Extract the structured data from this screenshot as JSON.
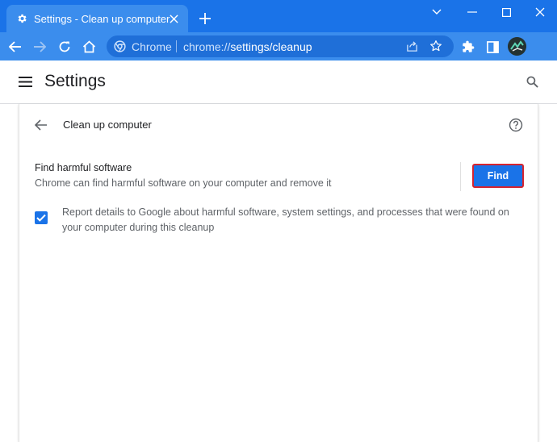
{
  "tab": {
    "title": "Settings - Clean up computer"
  },
  "omnibox": {
    "site_label": "Chrome",
    "url_prefix": "chrome://",
    "url_path": "settings/cleanup"
  },
  "header": {
    "title": "Settings"
  },
  "page": {
    "heading": "Clean up computer",
    "find_section": {
      "title": "Find harmful software",
      "description": "Chrome can find harmful software on your computer and remove it",
      "button_label": "Find"
    },
    "report": {
      "checked": true,
      "text": "Report details to Google about harmful software, system settings, and processes that were found on your computer during this cleanup"
    }
  },
  "icons": [
    "gear-icon",
    "close-icon",
    "plus-icon",
    "chevron-down-icon",
    "minimize-icon",
    "maximize-icon",
    "window-close-icon",
    "back-arrow-icon",
    "forward-arrow-icon",
    "reload-icon",
    "home-icon",
    "chrome-logo-icon",
    "share-icon",
    "star-icon",
    "extensions-icon",
    "side-panel-icon",
    "avatar",
    "menu-icon",
    "search-icon",
    "help-icon",
    "check-icon"
  ],
  "colors": {
    "brand_blue": "#1a73e8",
    "find_button_outline": "#d6242f"
  }
}
